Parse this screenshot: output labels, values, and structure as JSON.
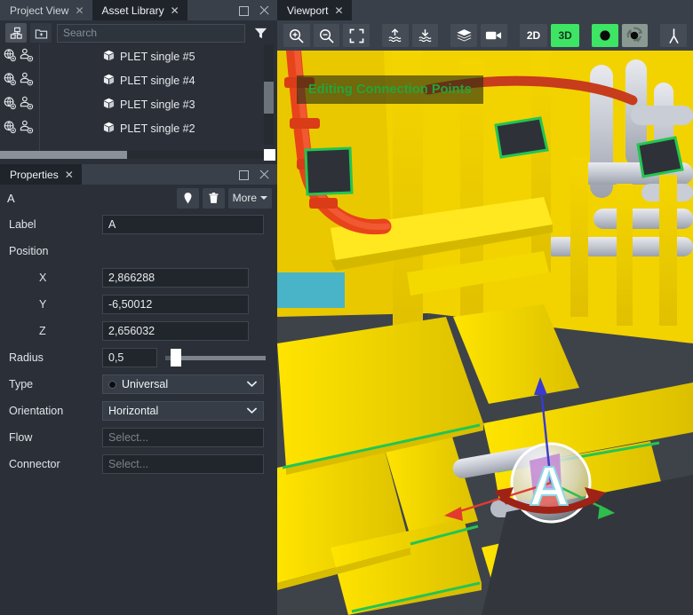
{
  "left_panel": {
    "tabs": [
      {
        "label": "Project View",
        "active": false,
        "close_icon": "close-icon"
      },
      {
        "label": "Asset Library",
        "active": true,
        "close_icon": "close-icon"
      }
    ],
    "window_controls": {
      "float_icon": "float-window-icon",
      "close_icon": "close-icon"
    },
    "toolbar": {
      "tree_view_icon": "tree-view-icon",
      "new_folder_icon": "new-folder-icon",
      "filter_icon": "filter-icon"
    },
    "search": {
      "placeholder": "Search",
      "value": ""
    },
    "tree_items": [
      {
        "label": "PLET single #5",
        "item_icon": "box-icon",
        "globe_icon": "add-globe-icon",
        "person_icon": "add-person-icon"
      },
      {
        "label": "PLET single #4",
        "item_icon": "box-icon",
        "globe_icon": "add-globe-icon",
        "person_icon": "add-person-icon"
      },
      {
        "label": "PLET single #3",
        "item_icon": "box-icon",
        "globe_icon": "add-globe-icon",
        "person_icon": "add-person-icon"
      },
      {
        "label": "PLET single #2",
        "item_icon": "box-icon",
        "globe_icon": "add-globe-icon",
        "person_icon": "add-person-icon"
      }
    ]
  },
  "properties": {
    "tab": {
      "label": "Properties",
      "close_icon": "close-icon"
    },
    "window_controls": {
      "float_icon": "float-window-icon",
      "close_icon": "close-icon"
    },
    "header": {
      "title": "A",
      "pin_icon": "map-pin-icon",
      "delete_icon": "trash-icon",
      "more_label": "More"
    },
    "fields": {
      "label_name": "Label",
      "label_value": "A",
      "position_name": "Position",
      "x_name": "X",
      "x_value": "2,866288",
      "y_name": "Y",
      "y_value": "-6,50012",
      "z_name": "Z",
      "z_value": "2,656032",
      "radius_name": "Radius",
      "radius_value": "0,5",
      "radius_percent": 8,
      "type_name": "Type",
      "type_value": "Universal",
      "orientation_name": "Orientation",
      "orientation_value": "Horizontal",
      "flow_name": "Flow",
      "flow_placeholder": "Select...",
      "connector_name": "Connector",
      "connector_placeholder": "Select..."
    }
  },
  "viewport": {
    "tab": {
      "label": "Viewport",
      "close_icon": "close-icon"
    },
    "toolbar": [
      {
        "name": "zoom-in-icon",
        "label": ""
      },
      {
        "name": "zoom-out-icon",
        "label": ""
      },
      {
        "name": "fit-to-screen-icon",
        "label": ""
      },
      {
        "name": "sea-surface-icon",
        "label": ""
      },
      {
        "name": "sea-bottom-icon",
        "label": ""
      },
      {
        "name": "layers-icon",
        "label": ""
      },
      {
        "name": "camera-icon",
        "label": ""
      },
      {
        "name": "view-2d-button",
        "label": "2D"
      },
      {
        "name": "view-3d-button",
        "label": "3D"
      },
      {
        "name": "sphere-icon",
        "label": ""
      },
      {
        "name": "orbit-sphere-icon",
        "label": ""
      },
      {
        "name": "measure-icon",
        "label": ""
      }
    ],
    "banner_text": "Editing Connection Points",
    "gizmo_label": "A"
  },
  "colors": {
    "accent_green": "#3ee564",
    "banner_text": "#23a53a",
    "panel_bg": "#2b3038",
    "tabbar_bg": "#3a4049"
  }
}
